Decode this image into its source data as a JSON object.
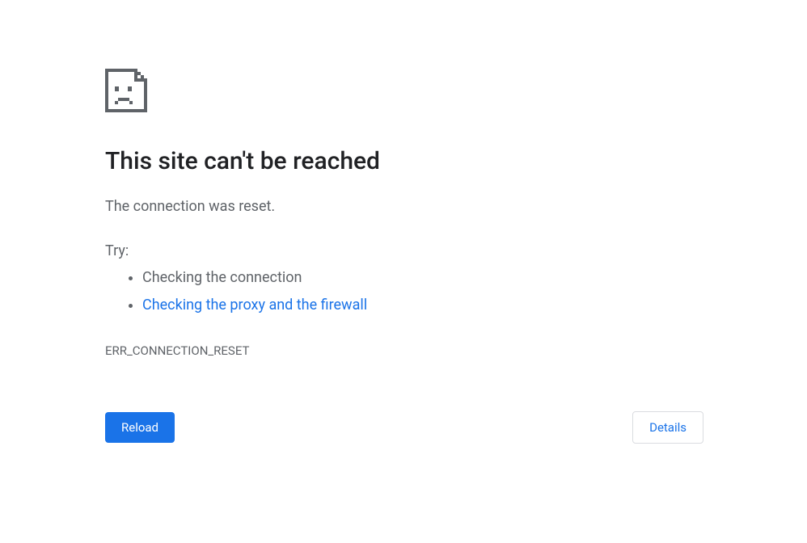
{
  "heading": "This site can't be reached",
  "message": "The connection was reset.",
  "try_label": "Try:",
  "suggestions": {
    "item1": "Checking the connection",
    "item2": "Checking the proxy and the firewall"
  },
  "error_code": "ERR_CONNECTION_RESET",
  "buttons": {
    "reload": "Reload",
    "details": "Details"
  }
}
